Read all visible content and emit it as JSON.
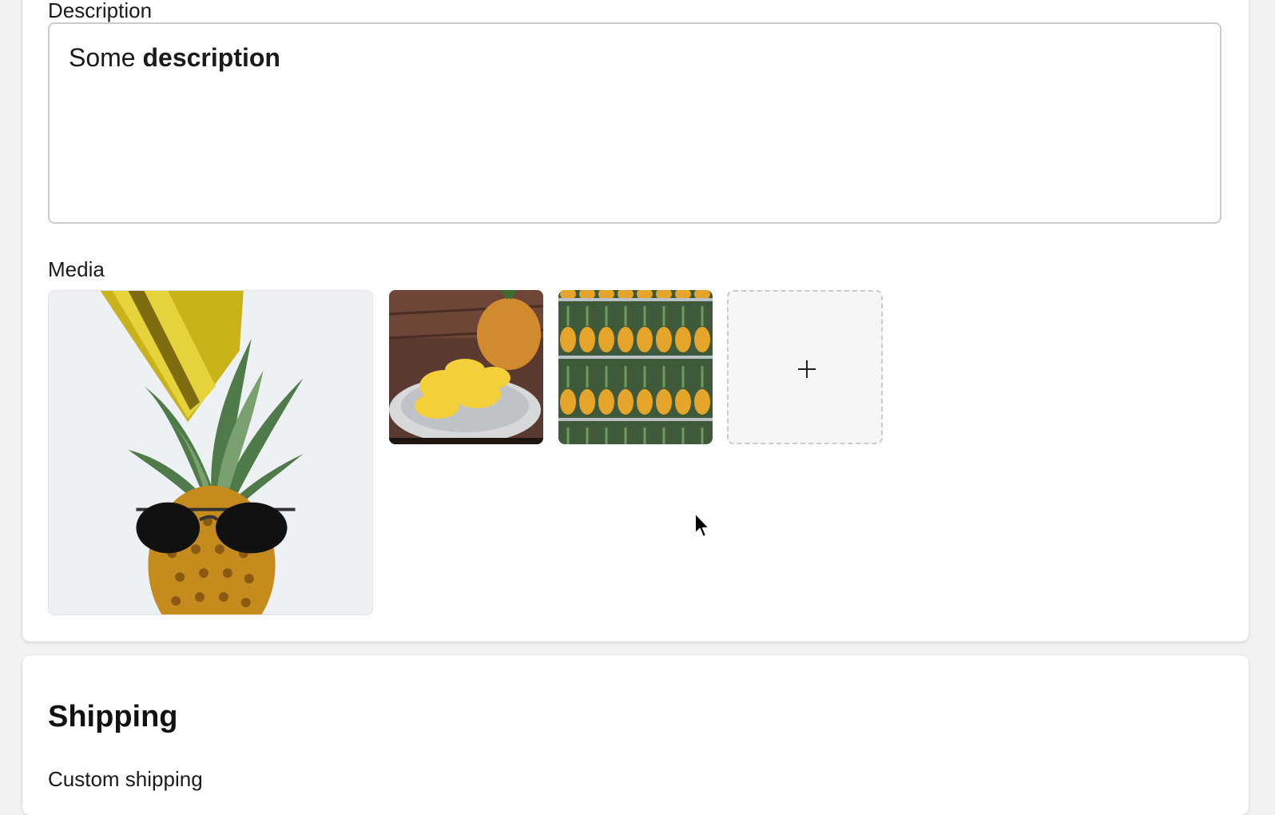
{
  "description": {
    "label": "Description",
    "text_plain": "Some ",
    "text_bold": "description"
  },
  "media": {
    "label": "Media",
    "images": [
      {
        "icon": "pineapple-sunglasses-image"
      },
      {
        "icon": "sliced-pineapple-plate-image"
      },
      {
        "icon": "pineapple-rows-image"
      }
    ],
    "add_icon": "plus-icon"
  },
  "shipping": {
    "title": "Shipping",
    "custom_shipping_label": "Custom shipping"
  }
}
